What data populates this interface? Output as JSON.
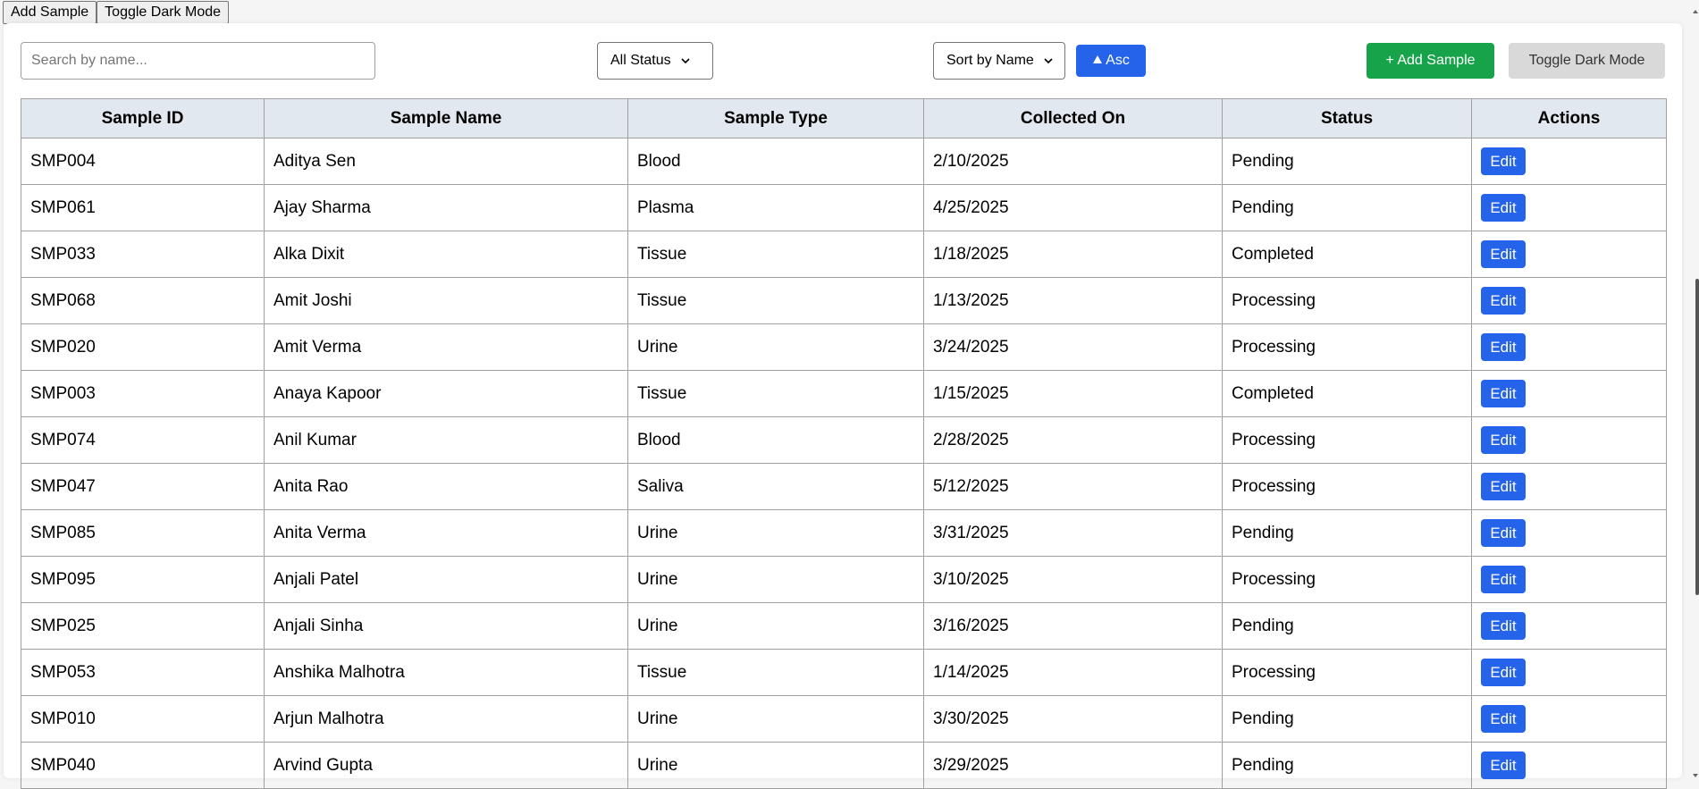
{
  "top_buttons": {
    "add_sample": "Add Sample",
    "toggle_dark": "Toggle Dark Mode"
  },
  "toolbar": {
    "search_placeholder": "Search by name...",
    "status_filter": "All Status",
    "sort_by": "Sort by Name",
    "sort_order": "Asc",
    "add_sample": "+ Add Sample",
    "toggle_dark": "Toggle Dark Mode"
  },
  "table": {
    "headers": [
      "Sample ID",
      "Sample Name",
      "Sample Type",
      "Collected On",
      "Status",
      "Actions"
    ],
    "edit_label": "Edit",
    "rows": [
      {
        "id": "SMP004",
        "name": "Aditya Sen",
        "type": "Blood",
        "collected": "2/10/2025",
        "status": "Pending"
      },
      {
        "id": "SMP061",
        "name": "Ajay Sharma",
        "type": "Plasma",
        "collected": "4/25/2025",
        "status": "Pending"
      },
      {
        "id": "SMP033",
        "name": "Alka Dixit",
        "type": "Tissue",
        "collected": "1/18/2025",
        "status": "Completed"
      },
      {
        "id": "SMP068",
        "name": "Amit Joshi",
        "type": "Tissue",
        "collected": "1/13/2025",
        "status": "Processing"
      },
      {
        "id": "SMP020",
        "name": "Amit Verma",
        "type": "Urine",
        "collected": "3/24/2025",
        "status": "Processing"
      },
      {
        "id": "SMP003",
        "name": "Anaya Kapoor",
        "type": "Tissue",
        "collected": "1/15/2025",
        "status": "Completed"
      },
      {
        "id": "SMP074",
        "name": "Anil Kumar",
        "type": "Blood",
        "collected": "2/28/2025",
        "status": "Processing"
      },
      {
        "id": "SMP047",
        "name": "Anita Rao",
        "type": "Saliva",
        "collected": "5/12/2025",
        "status": "Processing"
      },
      {
        "id": "SMP085",
        "name": "Anita Verma",
        "type": "Urine",
        "collected": "3/31/2025",
        "status": "Pending"
      },
      {
        "id": "SMP095",
        "name": "Anjali Patel",
        "type": "Urine",
        "collected": "3/10/2025",
        "status": "Processing"
      },
      {
        "id": "SMP025",
        "name": "Anjali Sinha",
        "type": "Urine",
        "collected": "3/16/2025",
        "status": "Pending"
      },
      {
        "id": "SMP053",
        "name": "Anshika Malhotra",
        "type": "Tissue",
        "collected": "1/14/2025",
        "status": "Processing"
      },
      {
        "id": "SMP010",
        "name": "Arjun Malhotra",
        "type": "Urine",
        "collected": "3/30/2025",
        "status": "Pending"
      },
      {
        "id": "SMP040",
        "name": "Arvind Gupta",
        "type": "Urine",
        "collected": "3/29/2025",
        "status": "Pending"
      }
    ]
  },
  "icons": {
    "sort_order": "triangle-up-icon",
    "select_arrow": "chevron-down-icon"
  },
  "colors": {
    "primary": "#2563eb",
    "success": "#16a34a",
    "header_bg": "#e2e8f0",
    "secondary_btn": "#d9d9d9"
  }
}
